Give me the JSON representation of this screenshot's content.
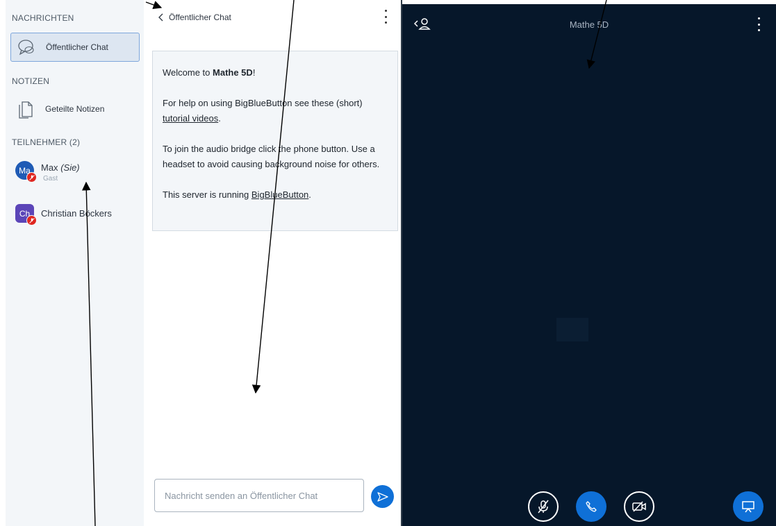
{
  "sidebar": {
    "messages_title": "NACHRICHTEN",
    "public_chat_label": "Öffentlicher Chat",
    "notes_title": "NOTIZEN",
    "shared_notes_label": "Geteilte Notizen",
    "participants_title": "TEILNEHMER (2)",
    "users": [
      {
        "initials": "Ma",
        "name": "Max",
        "you_tag": "(Sie)",
        "role": "Gast",
        "color": "#1f5bb5"
      },
      {
        "initials": "Ch",
        "name": "Christian Böckers",
        "color": "#5b45b8"
      }
    ]
  },
  "chat": {
    "title": "Öffentlicher Chat",
    "welcome": {
      "line1_pre": "Welcome to ",
      "line1_bold": "Mathe 5D",
      "line1_post": "!",
      "line2_pre": "For help on using BigBlueButton see these (short) ",
      "line2_link": "tutorial videos",
      "line2_post": ".",
      "line3": "To join the audio bridge click the phone button. Use a headset to avoid causing background noise for others.",
      "line4_pre": "This server is running ",
      "line4_link": "BigBlueButton",
      "line4_post": "."
    },
    "input_placeholder": "Nachricht senden an Öffentlicher Chat"
  },
  "main": {
    "title": "Mathe 5D"
  },
  "colors": {
    "accent": "#0f70d7",
    "main_bg": "#06172a",
    "sidebar_bg": "#f3f6f9",
    "badge_red": "#df2721"
  }
}
